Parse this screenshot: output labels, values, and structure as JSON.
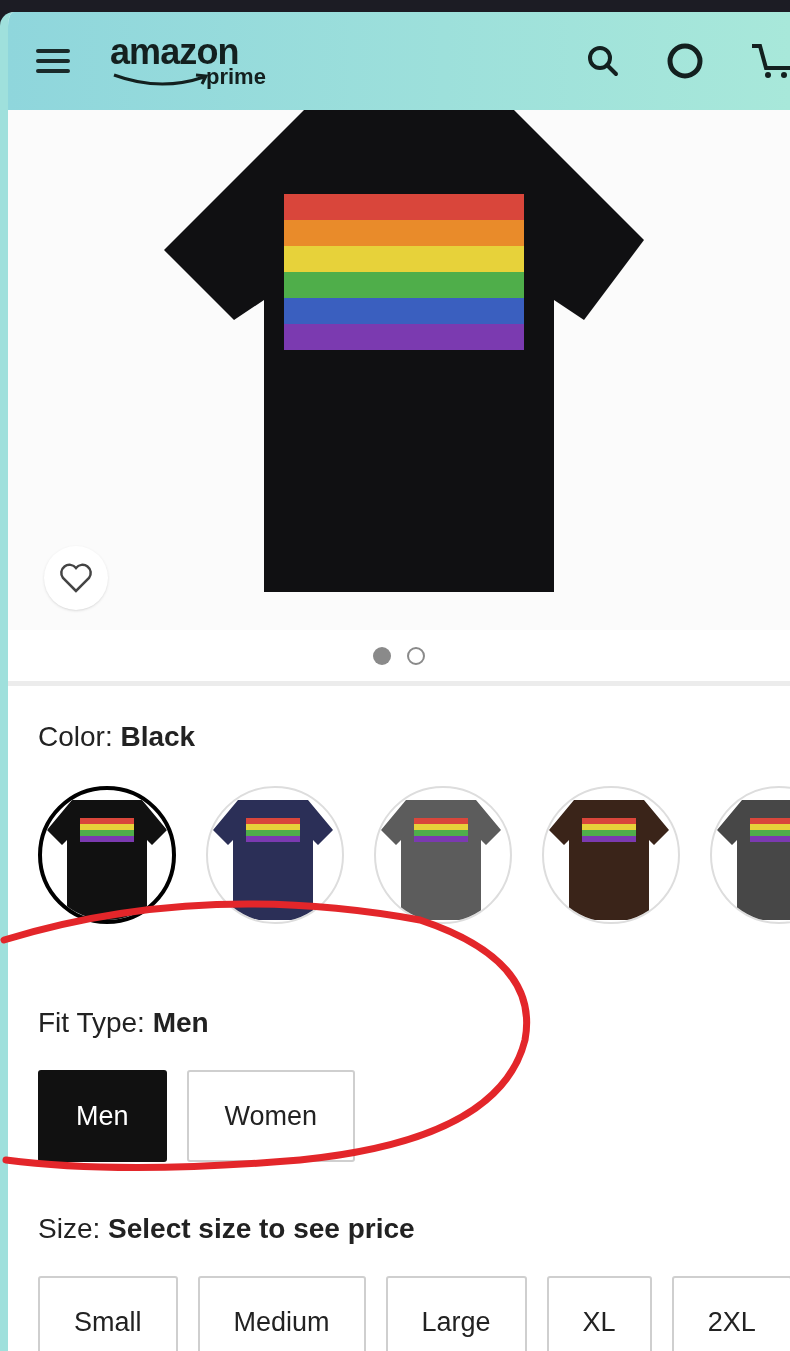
{
  "header": {
    "logo_word": "amazon",
    "logo_sub": "prime"
  },
  "carousel": {
    "dots": [
      {
        "selected": true
      },
      {
        "selected": false
      }
    ]
  },
  "color": {
    "label": "Color: ",
    "value": "Black",
    "swatches": [
      {
        "color": "#111111",
        "selected": true
      },
      {
        "color": "#2b2f57",
        "selected": false
      },
      {
        "color": "#5c5c5c",
        "selected": false
      },
      {
        "color": "#3a2419",
        "selected": false
      },
      {
        "color": "#474747",
        "selected": false
      }
    ]
  },
  "fit_type": {
    "label": "Fit Type: ",
    "value": "Men",
    "options": [
      {
        "label": "Men",
        "selected": true
      },
      {
        "label": "Women",
        "selected": false
      }
    ]
  },
  "size": {
    "label": "Size: ",
    "value": "Select size to see price",
    "options": [
      {
        "label": "Small"
      },
      {
        "label": "Medium"
      },
      {
        "label": "Large"
      },
      {
        "label": "XL"
      },
      {
        "label": "2XL"
      }
    ]
  }
}
